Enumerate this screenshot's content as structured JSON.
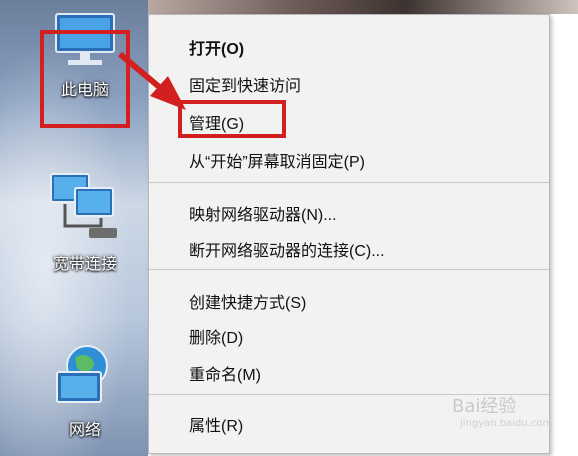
{
  "desktop": {
    "icons": [
      {
        "label": "此电脑",
        "icon": "computer-icon"
      },
      {
        "label": "宽带连接",
        "icon": "broadband-connection-icon"
      },
      {
        "label": "网络",
        "icon": "network-icon"
      }
    ]
  },
  "context_menu": {
    "items": [
      {
        "label": "打开(O)"
      },
      {
        "label": "固定到快速访问"
      },
      {
        "label": "管理(G)"
      },
      {
        "label": "从“开始”屏幕取消固定(P)"
      },
      {
        "label": "映射网络驱动器(N)..."
      },
      {
        "label": "断开网络驱动器的连接(C)..."
      },
      {
        "label": "创建快捷方式(S)"
      },
      {
        "label": "删除(D)"
      },
      {
        "label": "重命名(M)"
      },
      {
        "label": "属性(R)"
      }
    ]
  },
  "annotation": {
    "color": "#d21f1f"
  },
  "watermark": {
    "text": "Bai经验",
    "sub": "jingyan.baidu.com"
  }
}
